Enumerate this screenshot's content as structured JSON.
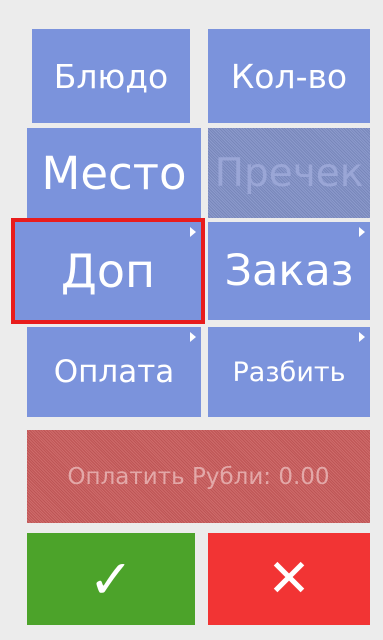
{
  "buttons": {
    "dish": "Блюдо",
    "quantity": "Кол-во",
    "place": "Место",
    "precheck": "Пречек",
    "extra": "Доп",
    "order": "Заказ",
    "payment": "Оплата",
    "split": "Разбить",
    "pay_total": "Оплатить Рубли: 0.00"
  },
  "icons": {
    "confirm": "✓",
    "cancel": "✕"
  },
  "colors": {
    "button_blue": "#7b93dc",
    "selected_outline": "#e81c1c",
    "confirm_green": "#4ca32a",
    "cancel_red": "#f23434"
  }
}
